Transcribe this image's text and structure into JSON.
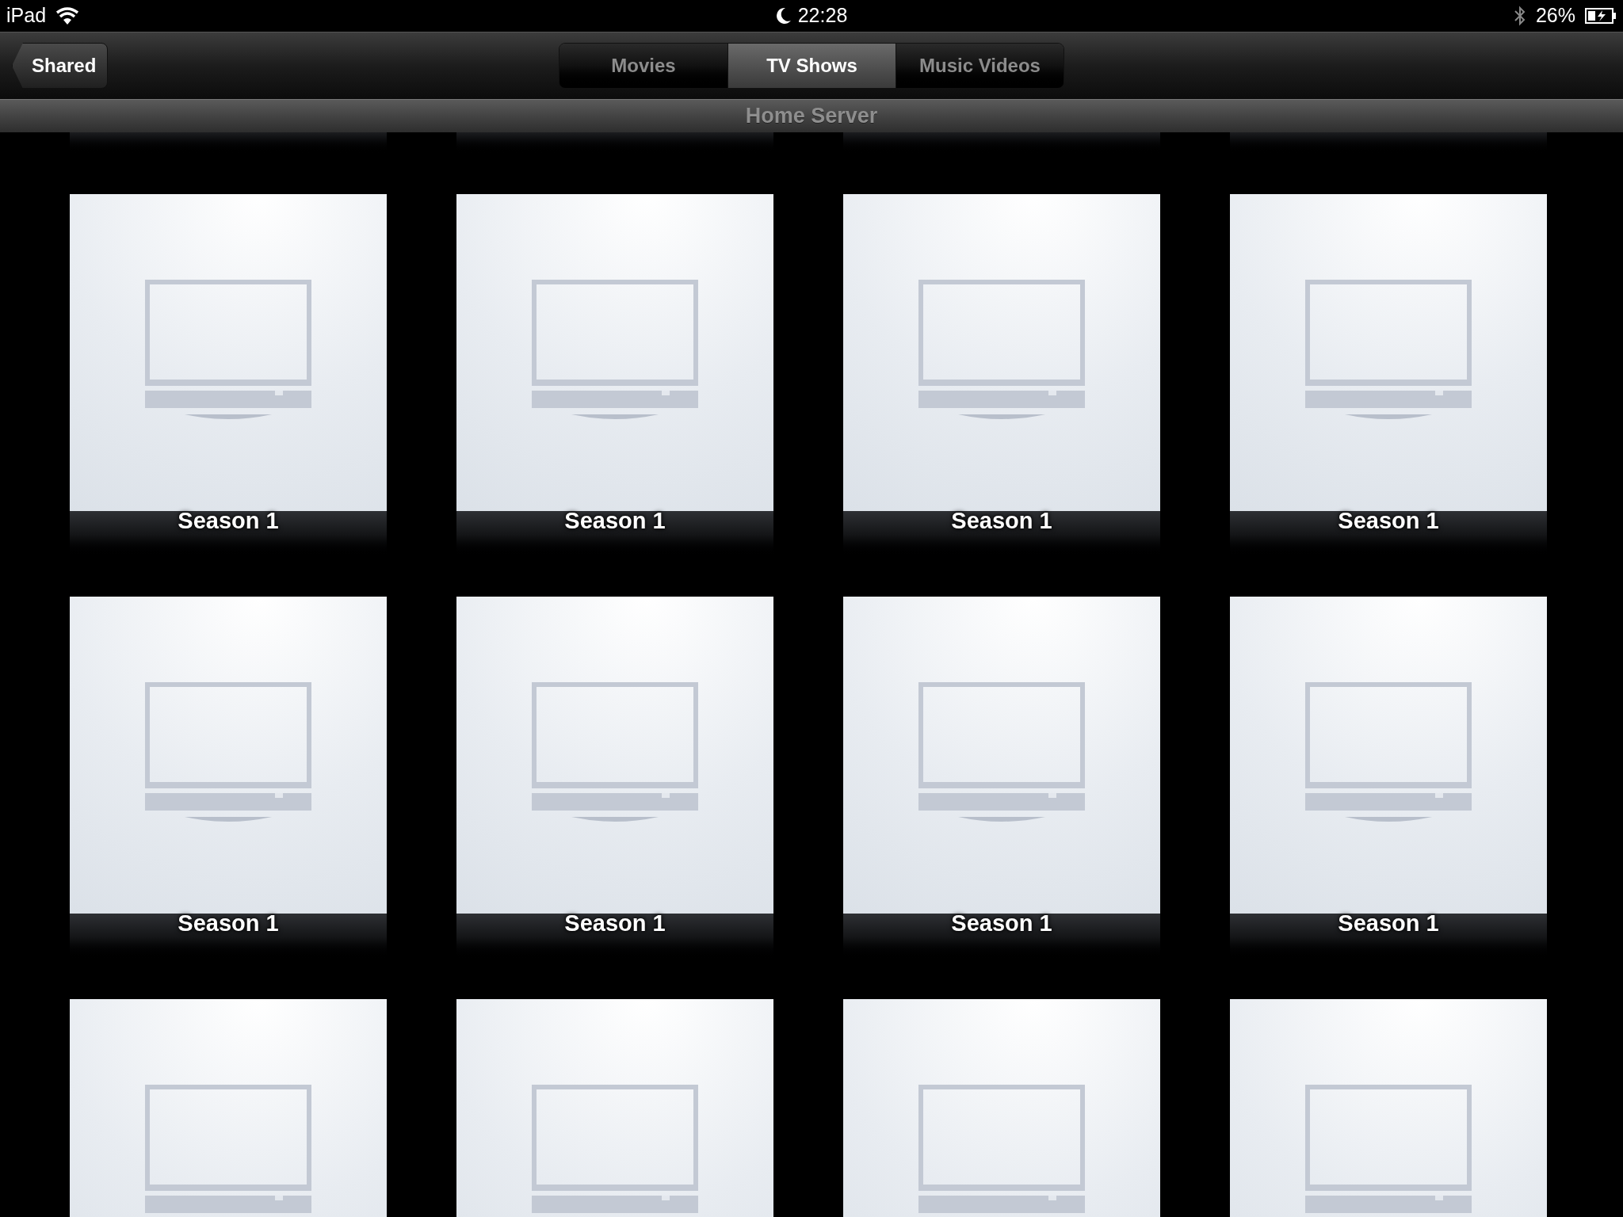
{
  "status_bar": {
    "device": "iPad",
    "time": "22:28",
    "battery": "26%"
  },
  "nav_bar": {
    "back_button": "Shared",
    "tabs": [
      {
        "label": "Movies",
        "selected": false
      },
      {
        "label": "TV Shows",
        "selected": true
      },
      {
        "label": "Music Videos",
        "selected": false
      }
    ]
  },
  "library_title": "Home Server",
  "cards": [
    {
      "kind": "tv-artwork",
      "title": "Season 1"
    },
    {
      "kind": "tv-artwork",
      "title": "Season 1"
    },
    {
      "kind": "tv-artwork",
      "title": "Season 1"
    },
    {
      "kind": "tv-artwork",
      "title": "Season 1"
    },
    {
      "kind": "tv-artwork",
      "title": "Season 1"
    },
    {
      "kind": "tv-artwork",
      "title": "Season 1"
    },
    {
      "kind": "tv-artwork",
      "title": "Season 1"
    },
    {
      "kind": "tv-artwork",
      "title": "Season 1"
    },
    {
      "kind": "tv-artwork"
    },
    {
      "kind": "tv-artwork"
    },
    {
      "kind": "tv-artwork"
    },
    {
      "kind": "tv-artwork"
    }
  ]
}
